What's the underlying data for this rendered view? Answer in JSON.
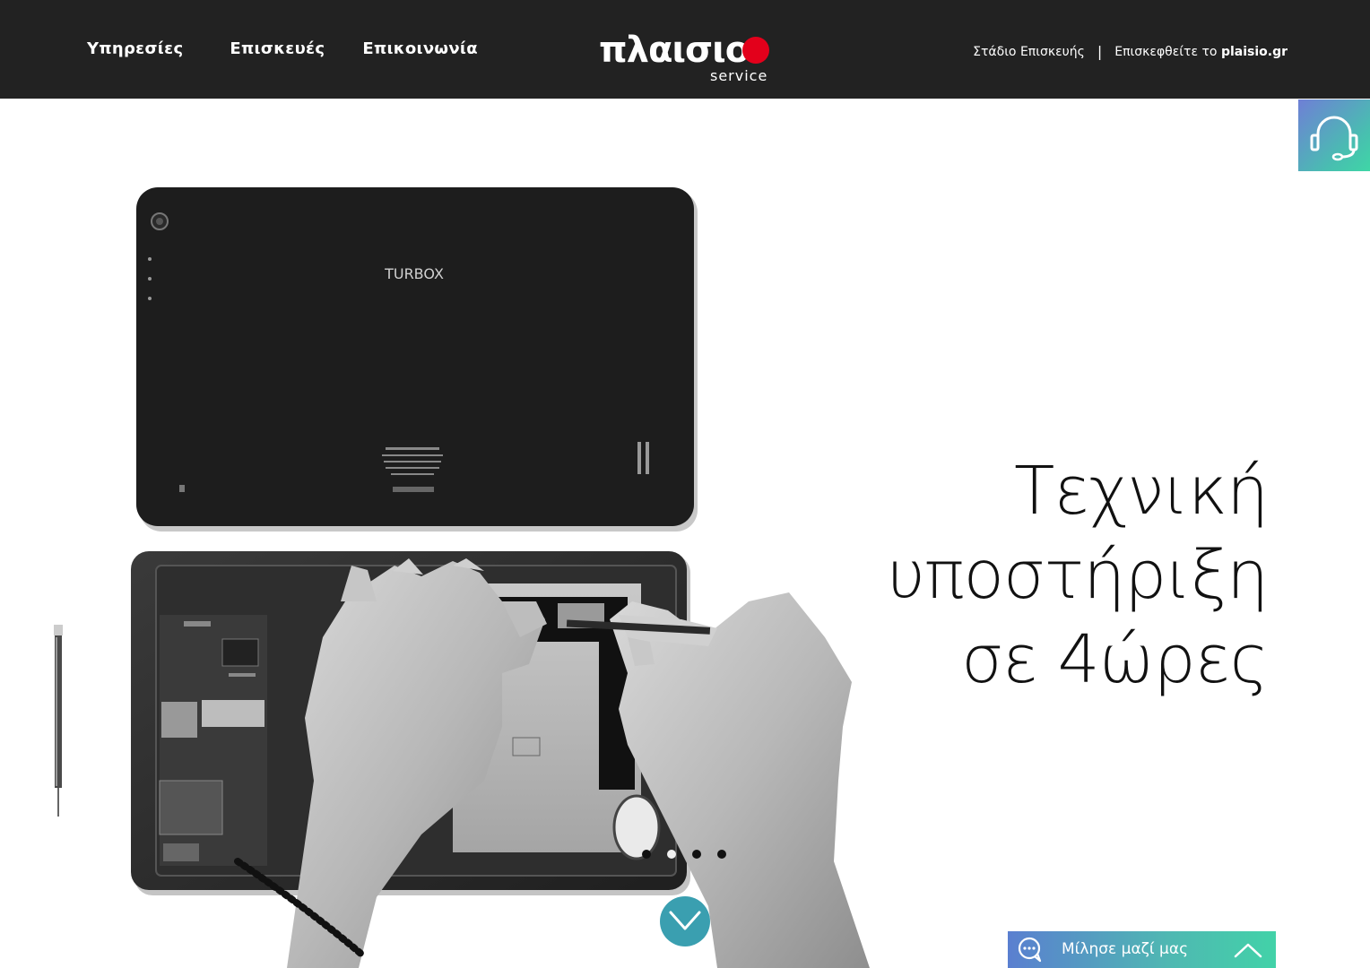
{
  "header": {
    "nav": [
      {
        "label": "Υπηρεσίες"
      },
      {
        "label": "Επισκευές"
      },
      {
        "label": "Επικοινωνία"
      }
    ],
    "logo": {
      "word": "πλαισιο",
      "sub": "service",
      "dot_color": "#e3001b"
    },
    "links": {
      "repair_status": "Στάδιο Επισκευής",
      "separator": "|",
      "visit_prefix": "Επισκεφθείτε το",
      "visit_site": "plaisio.gr"
    },
    "background": "#222222"
  },
  "support_tab": {
    "icon": "headset-icon"
  },
  "hero": {
    "title_line1": "Τεχνική υποστήριξη",
    "title_line2": "σε 4ώρες",
    "product_brand": "TURBOX",
    "slider": {
      "count": 4,
      "active": 2
    }
  },
  "scroll_down": {
    "icon": "chevron-down-icon",
    "color": "#3a9fb0"
  },
  "chat": {
    "label": "Μίλησε μαζί μας",
    "icon": "chat-bubble-icon",
    "toggle_icon": "chevron-up-icon"
  }
}
